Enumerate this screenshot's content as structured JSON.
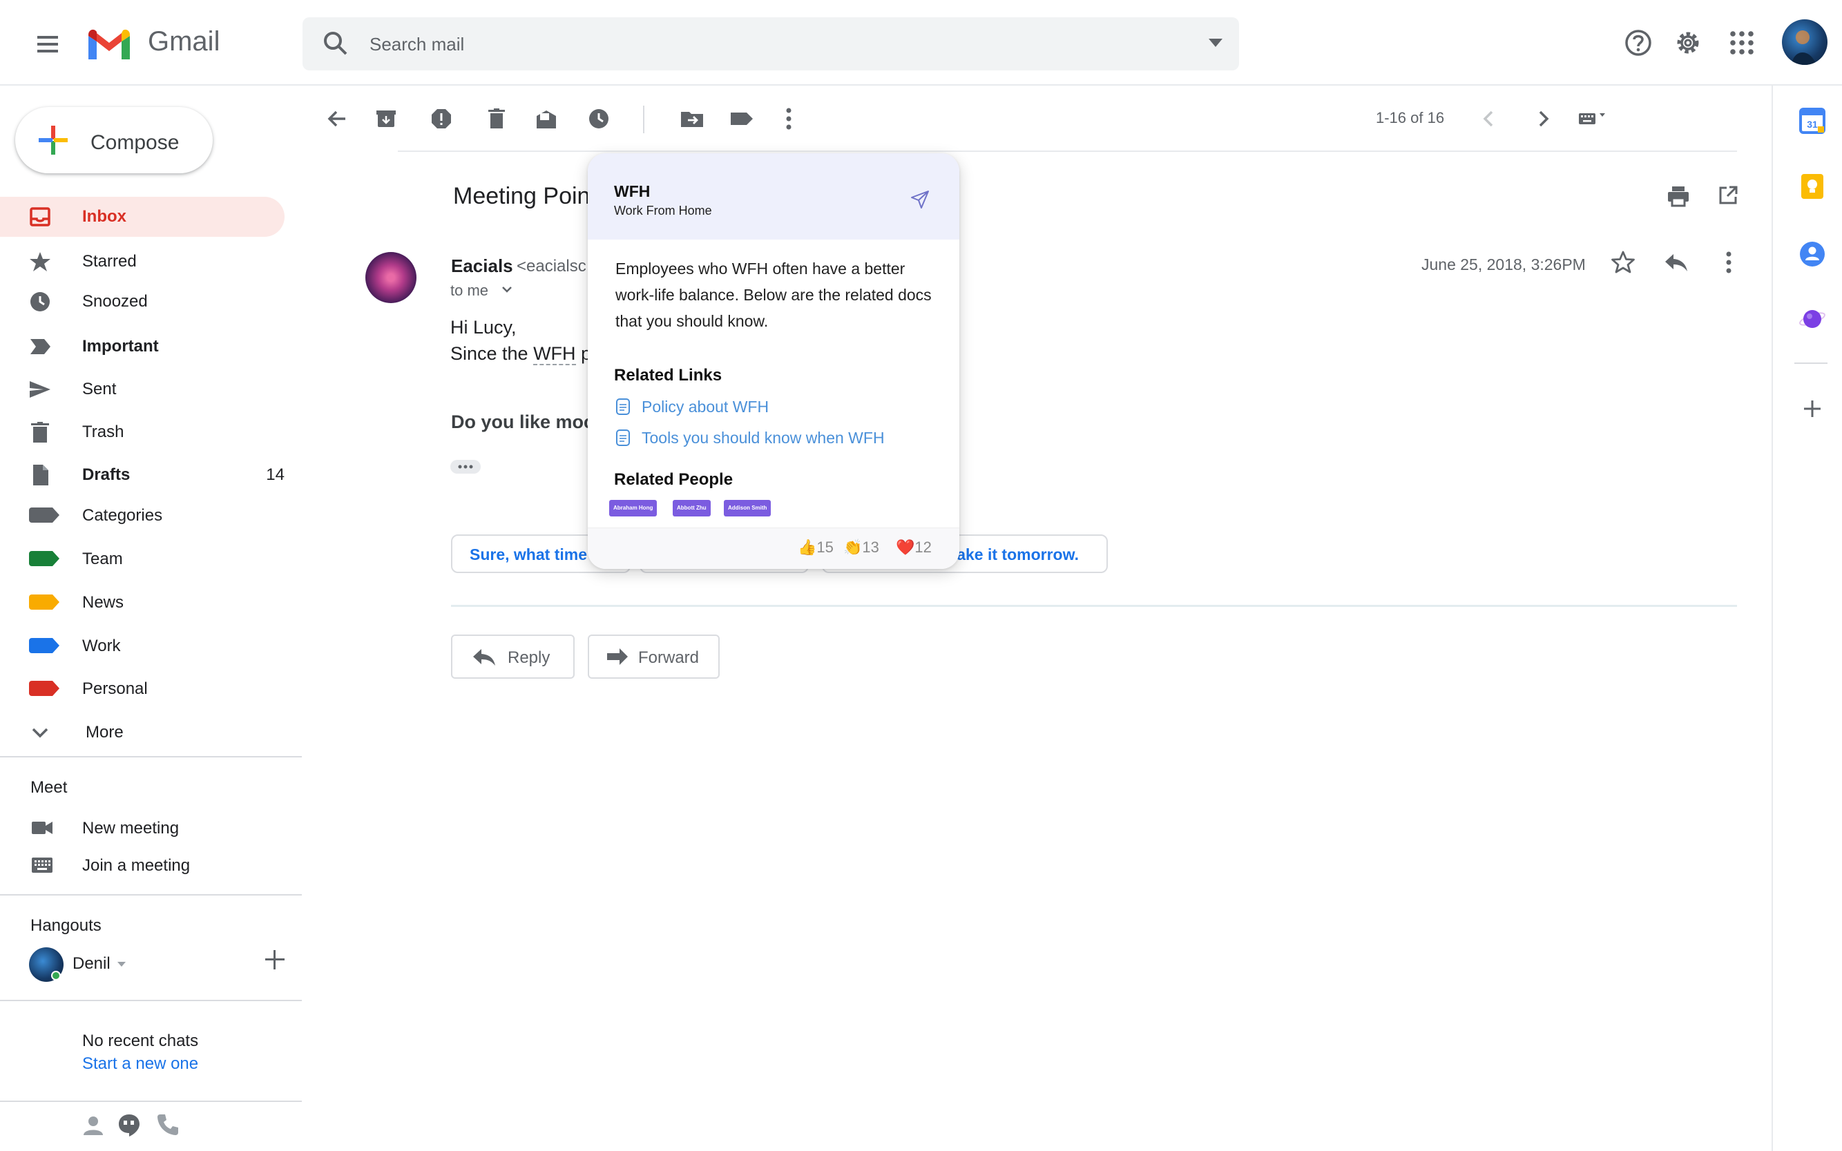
{
  "header": {
    "app_name": "Gmail",
    "search_placeholder": "Search mail"
  },
  "sidebar": {
    "compose_label": "Compose",
    "items": [
      {
        "label": "Inbox",
        "count": ""
      },
      {
        "label": "Starred",
        "count": ""
      },
      {
        "label": "Snoozed",
        "count": ""
      },
      {
        "label": "Important",
        "count": ""
      },
      {
        "label": "Sent",
        "count": ""
      },
      {
        "label": "Trash",
        "count": ""
      },
      {
        "label": "Drafts",
        "count": "14"
      },
      {
        "label": "Categories",
        "count": ""
      },
      {
        "label": "Team",
        "count": ""
      },
      {
        "label": "News",
        "count": ""
      },
      {
        "label": "Work",
        "count": ""
      },
      {
        "label": "Personal",
        "count": ""
      },
      {
        "label": "More",
        "count": ""
      }
    ],
    "label_colors": {
      "categories": "#5f6368",
      "team": "#188038",
      "news": "#f9ab00",
      "work": "#1a73e8",
      "personal": "#d93025"
    },
    "meet": {
      "title": "Meet",
      "new_meeting": "New meeting",
      "join_meeting": "Join a meeting"
    },
    "hangouts": {
      "title": "Hangouts",
      "user": "Denil",
      "no_chats": "No recent chats",
      "start_new": "Start a new one"
    }
  },
  "toolbar": {
    "pager": "1-16 of 16"
  },
  "email": {
    "subject": "Meeting Point",
    "sender_name": "Eacials",
    "sender_email": "<eacialsc",
    "to": "to me",
    "date": "June 25, 2018, 3:26PM",
    "greeting": "Hi Lucy,",
    "line1_prefix": "Since the ",
    "line1_term": "WFH",
    "line1_rest": " p",
    "line2": "Do you like moc",
    "smart_replies": [
      "Sure, what time",
      "ake it tomorrow."
    ],
    "reply_label": "Reply",
    "forward_label": "Forward"
  },
  "popup": {
    "title": "WFH",
    "subtitle": "Work From Home",
    "description": "Employees who WFH often have a better work-life balance. Below are the related docs that you should know.",
    "links_title": "Related Links",
    "links": [
      "Policy about WFH",
      "Tools you should know when WFH"
    ],
    "people_title": "Related People",
    "people": [
      "Abraham Hong",
      "Abbott Zhu",
      "Addison Smith"
    ],
    "reactions": [
      {
        "emoji": "👍",
        "count": "15"
      },
      {
        "emoji": "👏",
        "count": "13"
      },
      {
        "emoji": "❤️",
        "count": "12"
      }
    ]
  },
  "colors": {
    "accent": "#1a73e8",
    "inbox_red": "#d93025",
    "popup_chip": "#7b5ce0"
  }
}
